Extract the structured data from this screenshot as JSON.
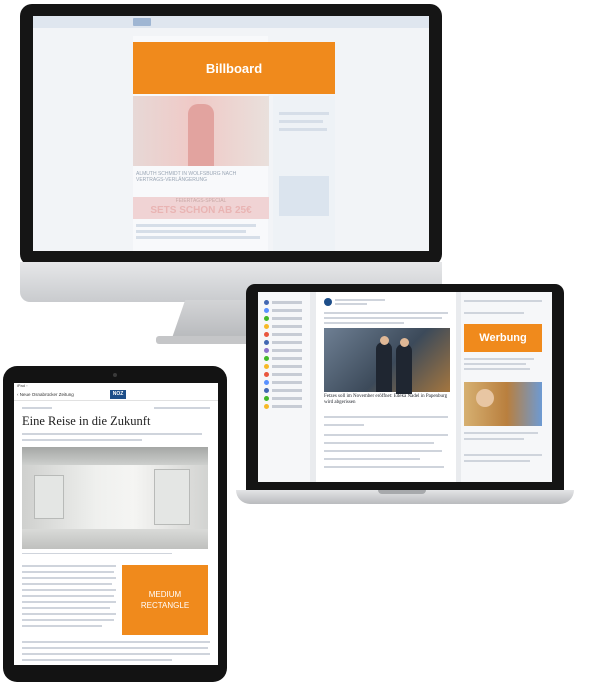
{
  "imac": {
    "billboard_label": "Billboard",
    "hero_headline": "ALMUTH SCHMIDT IN WOLFSBURG NACH VERTRAGS-VERLÄNGERUNG",
    "promo_title": "FEIERTAGS-SPECIAL",
    "promo_subtitle": "SETS SCHON AB 25€"
  },
  "macbook": {
    "ad_label": "Werbung",
    "post_caption": "Fetzes soll im November eröffnet: Edeka Nadel in Papenburg wird abgerissen"
  },
  "ipad": {
    "status_left": "iPad ◦",
    "back_label": "‹ Neue Osnabrücker Zeitung",
    "logo_text": "NOZ",
    "headline": "Eine Reise in die Zukunft",
    "medium_rect_line1": "MEDIUM",
    "medium_rect_line2": "RECTANGLE"
  },
  "colors": {
    "ad_orange": "#f08a1c",
    "device_black": "#151515"
  }
}
